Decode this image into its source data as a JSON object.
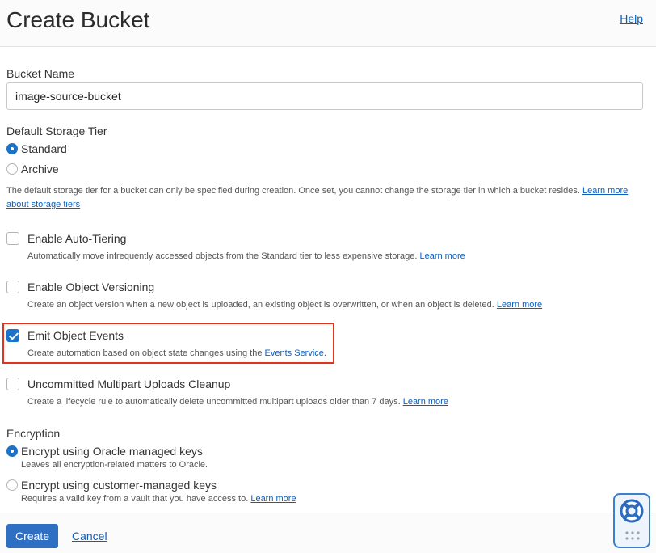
{
  "header": {
    "title": "Create Bucket",
    "help_label": "Help"
  },
  "bucket_name": {
    "label": "Bucket Name",
    "value": "image-source-bucket"
  },
  "storage_tier": {
    "label": "Default Storage Tier",
    "options": [
      {
        "label": "Standard",
        "selected": true
      },
      {
        "label": "Archive",
        "selected": false
      }
    ],
    "help_text": "The default storage tier for a bucket can only be specified during creation. Once set, you cannot change the storage tier in which a bucket resides.",
    "learn_more_line1": "Learn more",
    "learn_more_line2": "about storage tiers"
  },
  "options": [
    {
      "label": "Enable Auto-Tiering",
      "checked": false,
      "description": "Automatically move infrequently accessed objects from the Standard tier to less expensive storage.",
      "link": "Learn more"
    },
    {
      "label": "Enable Object Versioning",
      "checked": false,
      "description": "Create an object version when a new object is uploaded, an existing object is overwritten, or when an object is deleted.",
      "link": "Learn more"
    },
    {
      "label": "Emit Object Events",
      "checked": true,
      "description": "Create automation based on object state changes using the",
      "link": "Events Service."
    },
    {
      "label": "Uncommitted Multipart Uploads Cleanup",
      "checked": false,
      "description": "Create a lifecycle rule to automatically delete uncommitted multipart uploads older than 7 days.",
      "link": "Learn more"
    }
  ],
  "encryption": {
    "label": "Encryption",
    "options": [
      {
        "label": "Encrypt using Oracle managed keys",
        "description": "Leaves all encryption-related matters to Oracle.",
        "selected": true
      },
      {
        "label": "Encrypt using customer-managed keys",
        "description": "Requires a valid key from a vault that you have access to.",
        "link": "Learn more",
        "selected": false
      }
    ]
  },
  "footer": {
    "create_label": "Create",
    "cancel_label": "Cancel"
  },
  "colors": {
    "accent": "#2e6fc4",
    "highlight": "#e0321c",
    "link": "#0b5fbd"
  },
  "icons": {
    "support": "lifebuoy-icon",
    "grip": "grip-dots-icon"
  }
}
